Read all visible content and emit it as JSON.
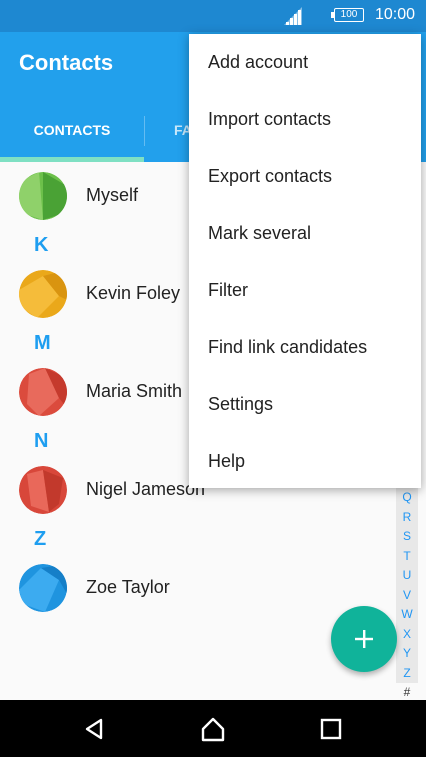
{
  "status_bar": {
    "battery": "100",
    "time": "10:00"
  },
  "app_bar": {
    "title": "Contacts",
    "tabs": [
      {
        "label": "CONTACTS"
      },
      {
        "label": "FA"
      }
    ]
  },
  "contacts": [
    {
      "name": "Myself",
      "section": ""
    },
    {
      "name": "Kevin Foley",
      "section": "K"
    },
    {
      "name": "Maria Smith",
      "section": "M"
    },
    {
      "name": "Nigel Jameson",
      "section": "N"
    },
    {
      "name": "Zoe Taylor",
      "section": "Z"
    }
  ],
  "alpha_index": [
    "Q",
    "R",
    "S",
    "T",
    "U",
    "V",
    "W",
    "X",
    "Y",
    "Z",
    "#"
  ],
  "fab": {
    "icon": "plus-icon"
  },
  "menu": {
    "items": [
      {
        "label": "Add account"
      },
      {
        "label": "Import contacts"
      },
      {
        "label": "Export contacts"
      },
      {
        "label": "Mark several"
      },
      {
        "label": "Filter"
      },
      {
        "label": "Find link candidates"
      },
      {
        "label": "Settings"
      },
      {
        "label": "Help"
      }
    ]
  },
  "nav_bar": {
    "icons": [
      "back-icon",
      "home-icon",
      "recents-icon"
    ]
  },
  "colors": {
    "status_bar": "#1e88d1",
    "app_bar": "#22a0ec",
    "tab_indicator": "#7fe0c3",
    "fab": "#10b39a",
    "accent": "#1e9ef0"
  }
}
